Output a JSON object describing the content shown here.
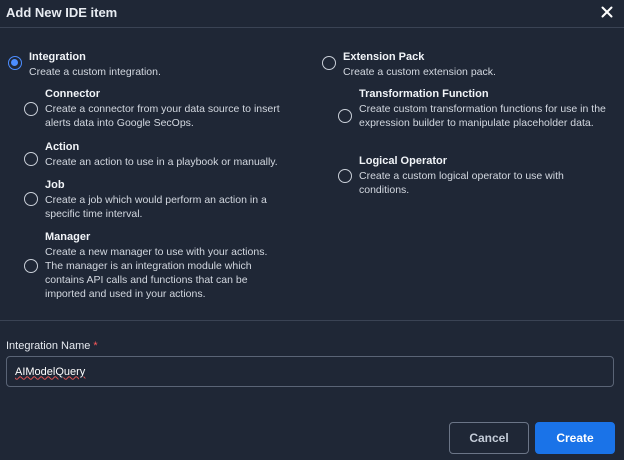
{
  "dialog": {
    "title": "Add New IDE item",
    "close_icon": "close-icon"
  },
  "options": [
    {
      "key": "integration",
      "title": "Integration",
      "description": "Create a custom integration.",
      "checked": true
    },
    {
      "key": "connector",
      "title": "Connector",
      "description": "Create a connector from your data source to insert alerts data into Google SecOps.",
      "checked": false
    },
    {
      "key": "action",
      "title": "Action",
      "description": "Create an action to use in a playbook or manually.",
      "checked": false
    },
    {
      "key": "job",
      "title": "Job",
      "description": "Create a job which would perform an action in a specific time interval.",
      "checked": false
    },
    {
      "key": "manager",
      "title": "Manager",
      "description": "Create a new manager to use with your actions. The manager is an integration module which contains API calls and functions that can be imported and used in your actions.",
      "checked": false
    },
    {
      "key": "extension-pack",
      "title": "Extension Pack",
      "description": "Create a custom extension pack.",
      "checked": false
    },
    {
      "key": "transformation-function",
      "title": "Transformation Function",
      "description": "Create custom transformation functions for use in the expression builder to manipulate placeholder data.",
      "checked": false
    },
    {
      "key": "logical-operator",
      "title": "Logical Operator",
      "description": "Create a custom logical operator to use with conditions.",
      "checked": false
    }
  ],
  "form": {
    "label": "Integration Name",
    "required_mark": "*",
    "value": "AIModelQuery"
  },
  "buttons": {
    "cancel": "Cancel",
    "create": "Create"
  },
  "colors": {
    "background": "#1f2736",
    "accent": "#1a73e8",
    "radio_checked": "#4c8dff",
    "required": "#ff5a5a"
  }
}
